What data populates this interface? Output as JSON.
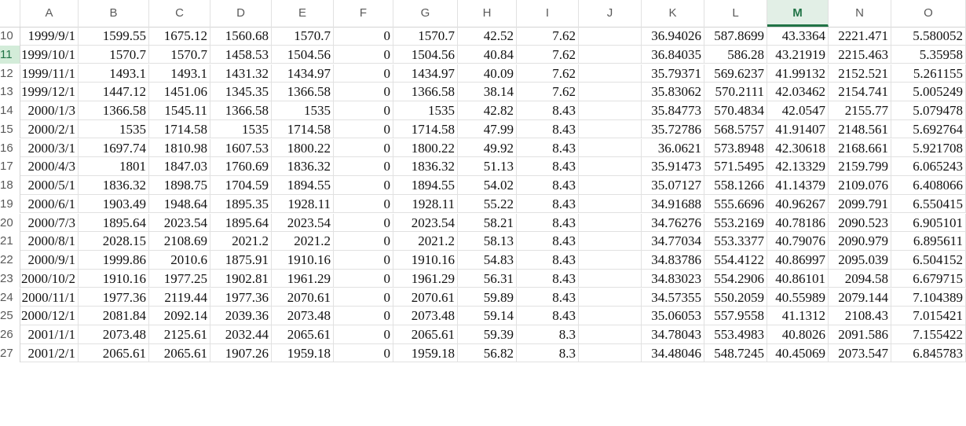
{
  "columns": [
    "A",
    "B",
    "C",
    "D",
    "E",
    "F",
    "G",
    "H",
    "I",
    "J",
    "K",
    "L",
    "M",
    "N",
    "O"
  ],
  "active_column": "M",
  "active_row": "11",
  "rows": [
    {
      "n": "10",
      "cells": [
        "1999/9/1",
        "1599.55",
        "1675.12",
        "1560.68",
        "1570.7",
        "0",
        "1570.7",
        "42.52",
        "7.62",
        "",
        "36.94026",
        "587.8699",
        "43.3364",
        "2221.471",
        "5.580052"
      ]
    },
    {
      "n": "11",
      "cells": [
        "1999/10/1",
        "1570.7",
        "1570.7",
        "1458.53",
        "1504.56",
        "0",
        "1504.56",
        "40.84",
        "7.62",
        "",
        "36.84035",
        "586.28",
        "43.21919",
        "2215.463",
        "5.35958"
      ]
    },
    {
      "n": "12",
      "cells": [
        "1999/11/1",
        "1493.1",
        "1493.1",
        "1431.32",
        "1434.97",
        "0",
        "1434.97",
        "40.09",
        "7.62",
        "",
        "35.79371",
        "569.6237",
        "41.99132",
        "2152.521",
        "5.261155"
      ]
    },
    {
      "n": "13",
      "cells": [
        "1999/12/1",
        "1447.12",
        "1451.06",
        "1345.35",
        "1366.58",
        "0",
        "1366.58",
        "38.14",
        "7.62",
        "",
        "35.83062",
        "570.2111",
        "42.03462",
        "2154.741",
        "5.005249"
      ]
    },
    {
      "n": "14",
      "cells": [
        "2000/1/3",
        "1366.58",
        "1545.11",
        "1366.58",
        "1535",
        "0",
        "1535",
        "42.82",
        "8.43",
        "",
        "35.84773",
        "570.4834",
        "42.0547",
        "2155.77",
        "5.079478"
      ]
    },
    {
      "n": "15",
      "cells": [
        "2000/2/1",
        "1535",
        "1714.58",
        "1535",
        "1714.58",
        "0",
        "1714.58",
        "47.99",
        "8.43",
        "",
        "35.72786",
        "568.5757",
        "41.91407",
        "2148.561",
        "5.692764"
      ]
    },
    {
      "n": "16",
      "cells": [
        "2000/3/1",
        "1697.74",
        "1810.98",
        "1607.53",
        "1800.22",
        "0",
        "1800.22",
        "49.92",
        "8.43",
        "",
        "36.0621",
        "573.8948",
        "42.30618",
        "2168.661",
        "5.921708"
      ]
    },
    {
      "n": "17",
      "cells": [
        "2000/4/3",
        "1801",
        "1847.03",
        "1760.69",
        "1836.32",
        "0",
        "1836.32",
        "51.13",
        "8.43",
        "",
        "35.91473",
        "571.5495",
        "42.13329",
        "2159.799",
        "6.065243"
      ]
    },
    {
      "n": "18",
      "cells": [
        "2000/5/1",
        "1836.32",
        "1898.75",
        "1704.59",
        "1894.55",
        "0",
        "1894.55",
        "54.02",
        "8.43",
        "",
        "35.07127",
        "558.1266",
        "41.14379",
        "2109.076",
        "6.408066"
      ]
    },
    {
      "n": "19",
      "cells": [
        "2000/6/1",
        "1903.49",
        "1948.64",
        "1895.35",
        "1928.11",
        "0",
        "1928.11",
        "55.22",
        "8.43",
        "",
        "34.91688",
        "555.6696",
        "40.96267",
        "2099.791",
        "6.550415"
      ]
    },
    {
      "n": "20",
      "cells": [
        "2000/7/3",
        "1895.64",
        "2023.54",
        "1895.64",
        "2023.54",
        "0",
        "2023.54",
        "58.21",
        "8.43",
        "",
        "34.76276",
        "553.2169",
        "40.78186",
        "2090.523",
        "6.905101"
      ]
    },
    {
      "n": "21",
      "cells": [
        "2000/8/1",
        "2028.15",
        "2108.69",
        "2021.2",
        "2021.2",
        "0",
        "2021.2",
        "58.13",
        "8.43",
        "",
        "34.77034",
        "553.3377",
        "40.79076",
        "2090.979",
        "6.895611"
      ]
    },
    {
      "n": "22",
      "cells": [
        "2000/9/1",
        "1999.86",
        "2010.6",
        "1875.91",
        "1910.16",
        "0",
        "1910.16",
        "54.83",
        "8.43",
        "",
        "34.83786",
        "554.4122",
        "40.86997",
        "2095.039",
        "6.504152"
      ]
    },
    {
      "n": "23",
      "cells": [
        "2000/10/2",
        "1910.16",
        "1977.25",
        "1902.81",
        "1961.29",
        "0",
        "1961.29",
        "56.31",
        "8.43",
        "",
        "34.83023",
        "554.2906",
        "40.86101",
        "2094.58",
        "6.679715"
      ]
    },
    {
      "n": "24",
      "cells": [
        "2000/11/1",
        "1977.36",
        "2119.44",
        "1977.36",
        "2070.61",
        "0",
        "2070.61",
        "59.89",
        "8.43",
        "",
        "34.57355",
        "550.2059",
        "40.55989",
        "2079.144",
        "7.104389"
      ]
    },
    {
      "n": "25",
      "cells": [
        "2000/12/1",
        "2081.84",
        "2092.14",
        "2039.36",
        "2073.48",
        "0",
        "2073.48",
        "59.14",
        "8.43",
        "",
        "35.06053",
        "557.9558",
        "41.1312",
        "2108.43",
        "7.015421"
      ]
    },
    {
      "n": "26",
      "cells": [
        "2001/1/1",
        "2073.48",
        "2125.61",
        "2032.44",
        "2065.61",
        "0",
        "2065.61",
        "59.39",
        "8.3",
        "",
        "34.78043",
        "553.4983",
        "40.8026",
        "2091.586",
        "7.155422"
      ]
    },
    {
      "n": "27",
      "cells": [
        "2001/2/1",
        "2065.61",
        "2065.61",
        "1907.26",
        "1959.18",
        "0",
        "1959.18",
        "56.82",
        "8.3",
        "",
        "34.48046",
        "548.7245",
        "40.45069",
        "2073.547",
        "6.845783"
      ]
    }
  ]
}
